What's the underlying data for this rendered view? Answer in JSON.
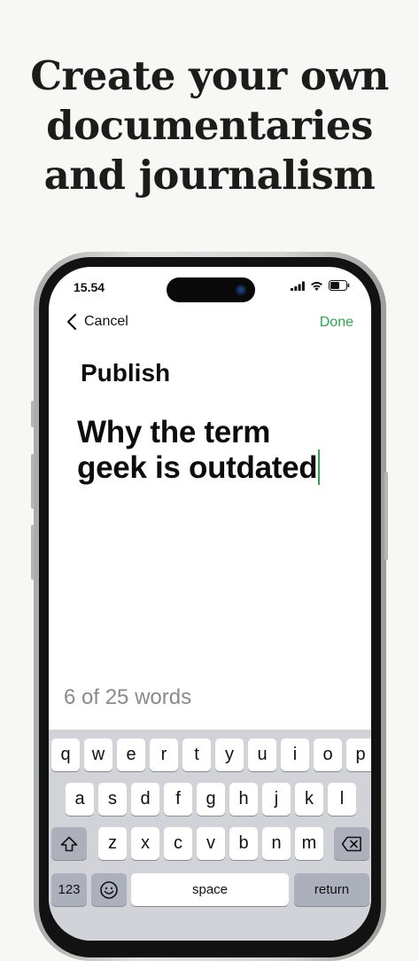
{
  "headline": [
    "Create your own",
    "documentaries",
    "and journalism"
  ],
  "status_bar": {
    "time": "15.54"
  },
  "nav": {
    "cancel": "Cancel",
    "done": "Done"
  },
  "section_title": "Publish",
  "title_text_lines": [
    "Why the term",
    "geek is outdated"
  ],
  "word_count": "6 of 25 words",
  "keyboard": {
    "row1": [
      "q",
      "w",
      "e",
      "r",
      "t",
      "y",
      "u",
      "i",
      "o",
      "p"
    ],
    "row2": [
      "a",
      "s",
      "d",
      "f",
      "g",
      "h",
      "j",
      "k",
      "l"
    ],
    "row3": [
      "z",
      "x",
      "c",
      "v",
      "b",
      "n",
      "m"
    ],
    "numbers": "123",
    "space": "space",
    "return": "return"
  },
  "colors": {
    "accent": "#2aa84a",
    "background": "#f7f7f6"
  },
  "icons": [
    "back-chevron-icon",
    "signal-icon",
    "wifi-icon",
    "battery-icon",
    "shift-icon",
    "backspace-icon",
    "emoji-icon"
  ]
}
